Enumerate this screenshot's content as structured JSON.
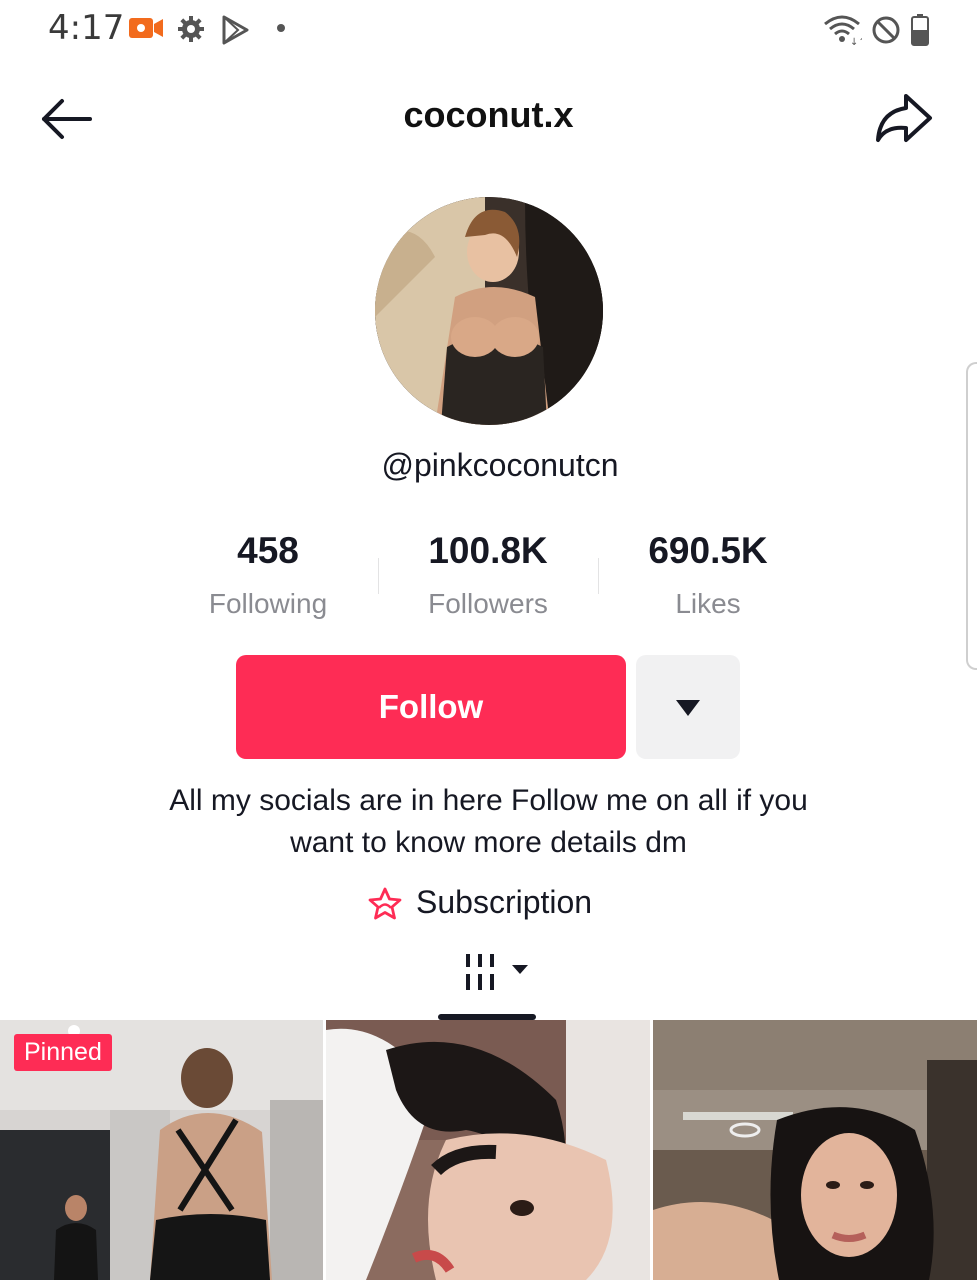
{
  "status_bar": {
    "time": "4:17",
    "icons": [
      "video-recording-icon",
      "gear-icon",
      "play-store-icon",
      "dot-icon",
      "wifi-icon",
      "do-not-disturb-icon",
      "battery-icon"
    ]
  },
  "header": {
    "title": "coconut.x",
    "back_icon": "arrow-left-icon",
    "share_icon": "share-arrow-icon"
  },
  "profile": {
    "handle": "@pinkcoconutcn",
    "avatar": "profile-photo"
  },
  "stats": [
    {
      "value": "458",
      "label": "Following"
    },
    {
      "value": "100.8K",
      "label": "Followers"
    },
    {
      "value": "690.5K",
      "label": "Likes"
    }
  ],
  "actions": {
    "follow_label": "Follow",
    "dropdown_icon": "caret-down-icon"
  },
  "bio": {
    "line1": "All my socials are in here Follow me on all if you",
    "line2": "want to know more details dm"
  },
  "subscription": {
    "label": "Subscription",
    "icon": "star-badge-icon"
  },
  "tabs": {
    "videos_icon": "grid-videos-icon"
  },
  "videos": [
    {
      "pinned_label": "Pinned"
    },
    {},
    {}
  ],
  "colors": {
    "accent": "#fe2c55",
    "text_primary": "#161823",
    "text_secondary": "#8a8b91",
    "button_secondary": "#f1f1f2"
  }
}
